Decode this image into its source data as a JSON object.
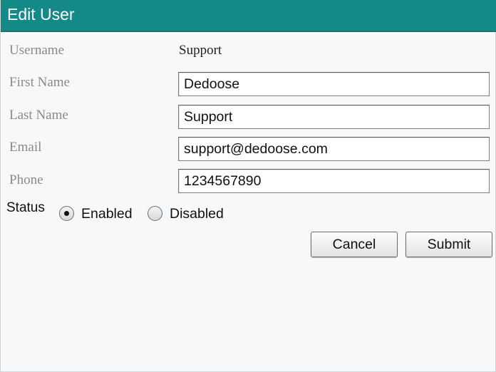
{
  "dialog": {
    "title": "Edit User"
  },
  "form": {
    "username": {
      "label": "Username",
      "value": "Support"
    },
    "first_name": {
      "label": "First Name",
      "value": "Dedoose"
    },
    "last_name": {
      "label": "Last Name",
      "value": "Support"
    },
    "email": {
      "label": "Email",
      "value": "support@dedoose.com"
    },
    "phone": {
      "label": "Phone",
      "value": "1234567890"
    },
    "status": {
      "label": "Status",
      "options": [
        "Enabled",
        "Disabled"
      ],
      "selected": "Enabled"
    }
  },
  "buttons": {
    "cancel": "Cancel",
    "submit": "Submit"
  },
  "colors": {
    "title_bar": "#138a88",
    "background": "#f6f8f9"
  }
}
